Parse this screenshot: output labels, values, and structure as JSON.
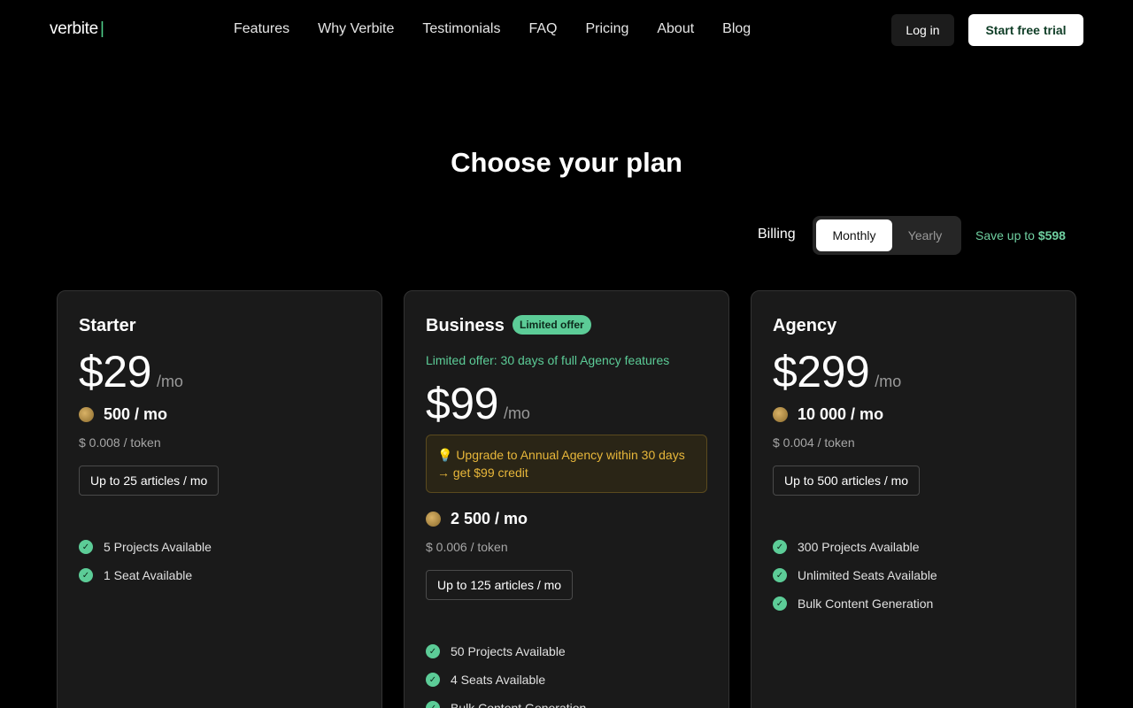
{
  "nav": {
    "logo": "verbite",
    "logo_cursor": "|",
    "links": [
      "Features",
      "Why Verbite",
      "Testimonials",
      "FAQ",
      "Pricing",
      "About",
      "Blog"
    ],
    "login": "Log in",
    "trial": "Start free trial"
  },
  "title": "Choose your plan",
  "billing": {
    "label": "Billing",
    "monthly": "Monthly",
    "yearly": "Yearly",
    "selected": "Monthly",
    "save_prefix": "Save up to",
    "save_amount": "$598"
  },
  "plans": {
    "starter": {
      "name": "Starter",
      "price": "$29",
      "per": "/mo",
      "tokens": "500 / mo",
      "token_price": "$ 0.008 / token",
      "articles": "Up to 25 articles / mo",
      "features": [
        "5 Projects Available",
        "1 Seat Available"
      ]
    },
    "business": {
      "name": "Business",
      "badge": "Limited offer",
      "offer": "Limited offer: 30 days of full Agency features",
      "price": "$99",
      "per": "/mo",
      "promo_line1": "💡 Upgrade to Annual Agency within 30 days",
      "promo_line2": "→ get $99 credit",
      "tokens": "2 500 / mo",
      "token_price": "$ 0.006 / token",
      "articles": "Up to 125 articles / mo",
      "features": [
        "50 Projects Available",
        "4 Seats Available",
        "Bulk Content Generation"
      ]
    },
    "agency": {
      "name": "Agency",
      "price": "$299",
      "per": "/mo",
      "tokens": "10 000 / mo",
      "token_price": "$ 0.004 / token",
      "articles": "Up to 500 articles / mo",
      "features": [
        "300 Projects Available",
        "Unlimited Seats Available",
        "Bulk Content Generation"
      ]
    }
  },
  "colors": {
    "accent_green": "#5ccc97",
    "promo_yellow": "#e8b73a",
    "background": "#000000",
    "card": "#1a1a1a"
  },
  "icons": {
    "check": "check-circle-icon",
    "coin": "coin-icon"
  }
}
